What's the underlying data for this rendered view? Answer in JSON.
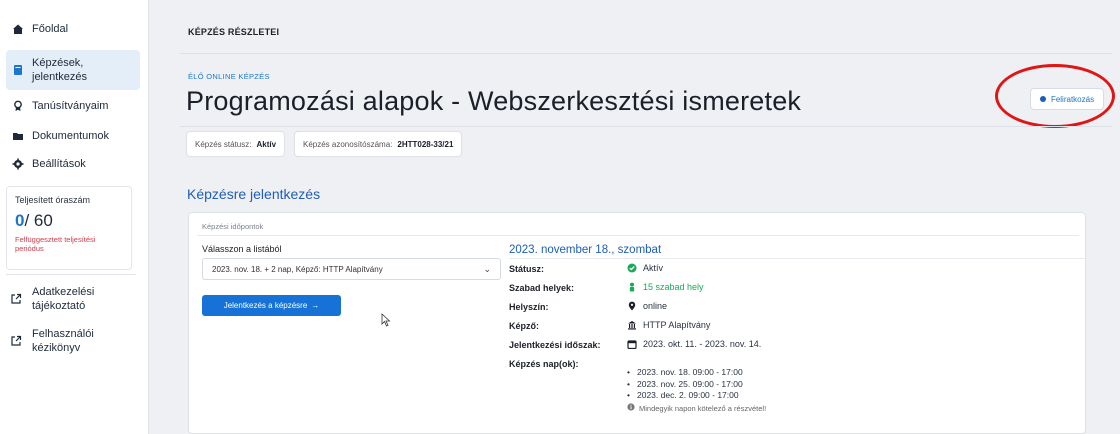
{
  "sidebar": {
    "items": [
      {
        "label": "Főoldal",
        "icon": "home-icon"
      },
      {
        "label": "Képzések, jelentkezés",
        "icon": "book-icon"
      },
      {
        "label": "Tanúsítványaim",
        "icon": "certificate-icon"
      },
      {
        "label": "Dokumentumok",
        "icon": "folder-icon"
      },
      {
        "label": "Beállítások",
        "icon": "gear-icon"
      }
    ],
    "hours": {
      "title": "Teljesített óraszám",
      "value": "0",
      "total": "/ 60",
      "note": "Felfüggesztett teljesítési periódus"
    },
    "links": [
      {
        "label": "Adatkezelési tájékoztató",
        "icon": "external-link-icon"
      },
      {
        "label": "Felhasználói kézikönyv",
        "icon": "external-link-icon"
      }
    ]
  },
  "header": {
    "breadcrumb": "KÉPZÉS RÉSZLETEI",
    "kicker": "ÉLŐ ONLINE KÉPZÉS",
    "title": "Programozási alapok - Webszerkesztési ismeretek",
    "subscribe_label": "Feliratkozás",
    "status_label": "Képzés státusz:",
    "status_value": "Aktív",
    "id_label": "Képzés azonosítószáma:",
    "id_value": "2HTT028-33/21"
  },
  "signup": {
    "section_title": "Képzésre jelentkezés",
    "card_label": "Képzési időpontok",
    "select_label": "Válasszon a listából",
    "select_value": "2023. nov. 18. + 2 nap, Képző: HTTP Alapítvány",
    "apply_label": "Jelentkezés a képzésre",
    "apply_arrow": "→"
  },
  "details": {
    "date": "2023. november 18., szombat",
    "rows": [
      {
        "label": "Státusz:",
        "value": "Aktív",
        "icon": "check-circle-icon"
      },
      {
        "label": "Szabad helyek:",
        "value": "15 szabad hely",
        "icon": "person-icon"
      },
      {
        "label": "Helyszín:",
        "value": "online",
        "icon": "location-pin-icon"
      },
      {
        "label": "Képző:",
        "value": "HTTP Alapítvány",
        "icon": "institution-icon"
      },
      {
        "label": "Jelentkezési időszak:",
        "value": "2023. okt. 11. - 2023. nov. 14.",
        "icon": "calendar-icon"
      },
      {
        "label": "Képzés nap(ok):",
        "value": "",
        "icon": ""
      }
    ],
    "days": [
      "2023. nov. 18. 09:00 - 17:00",
      "2023. nov. 25. 09:00 - 17:00",
      "2023. dec. 2. 09:00 - 17:00"
    ],
    "mandatory_note": "Mindegyik napon kötelező a részvétel!"
  },
  "colors": {
    "accent": "#1e76c8",
    "primary_button": "#1672d6",
    "success": "#1aa85a",
    "warning_text": "#d04050",
    "annotation_oval": "#e01515"
  }
}
